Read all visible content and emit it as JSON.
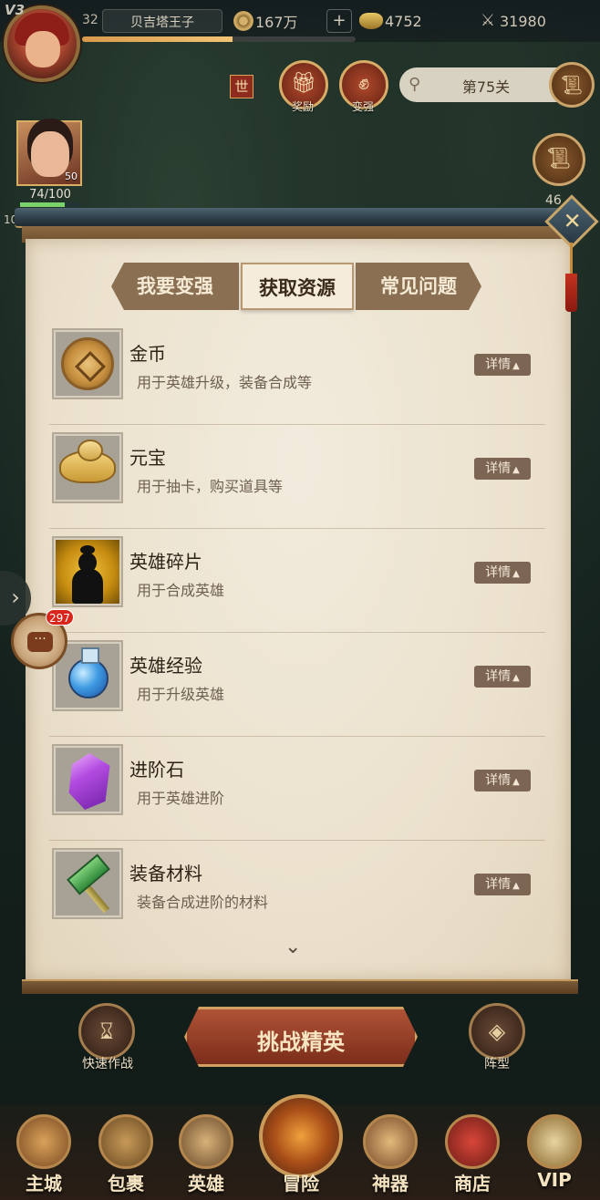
{
  "topbar": {
    "vip": "V3",
    "level": "32",
    "player_name": "贝吉塔王子",
    "copper": "167万",
    "plus": "+",
    "ingot": "4752",
    "power": "31980",
    "exp_fraction": 0.55
  },
  "quick": {
    "world_label": "世",
    "reward_label": "奖励",
    "upgrade_label": "变强",
    "stage_label": "第75关"
  },
  "hero": {
    "level": "50",
    "hp_text": "74/100",
    "hp_fraction": 0.74,
    "left_number": "10",
    "right_number": "46"
  },
  "modal": {
    "close_label": "✕",
    "tabs": [
      {
        "label": "我要变强"
      },
      {
        "label": "获取资源"
      },
      {
        "label": "常见问题"
      }
    ],
    "active_tab": "获取资源",
    "detail_label": "详情",
    "items": [
      {
        "name": "金币",
        "desc": "用于英雄升级，装备合成等",
        "icon": "coin-icon"
      },
      {
        "name": "元宝",
        "desc": "用于抽卡，购买道具等",
        "icon": "ingot-icon"
      },
      {
        "name": "英雄碎片",
        "desc": "用于合成英雄",
        "icon": "hero-shard-icon"
      },
      {
        "name": "英雄经验",
        "desc": "用于升级英雄",
        "icon": "exp-potion-icon"
      },
      {
        "name": "进阶石",
        "desc": "用于英雄进阶",
        "icon": "advance-stone-icon"
      },
      {
        "name": "装备材料",
        "desc": "装备合成进阶的材料",
        "icon": "equip-material-icon"
      }
    ]
  },
  "side": {
    "chat_badge": "297"
  },
  "bottom": {
    "quick_battle_label": "快速作战",
    "challenge_label": "挑战精英",
    "formation_label": "阵型",
    "nav": [
      {
        "label": "主城"
      },
      {
        "label": "包裹"
      },
      {
        "label": "英雄"
      },
      {
        "label": "冒险"
      },
      {
        "label": "神器"
      },
      {
        "label": "商店"
      },
      {
        "label": "VIP"
      }
    ]
  },
  "colors": {
    "tab_inactive": "#8b6f53",
    "tab_active": "#f5ecdb",
    "detail_button": "#7d6554",
    "paper": "#ebe1cd",
    "badge": "#d8261c"
  }
}
